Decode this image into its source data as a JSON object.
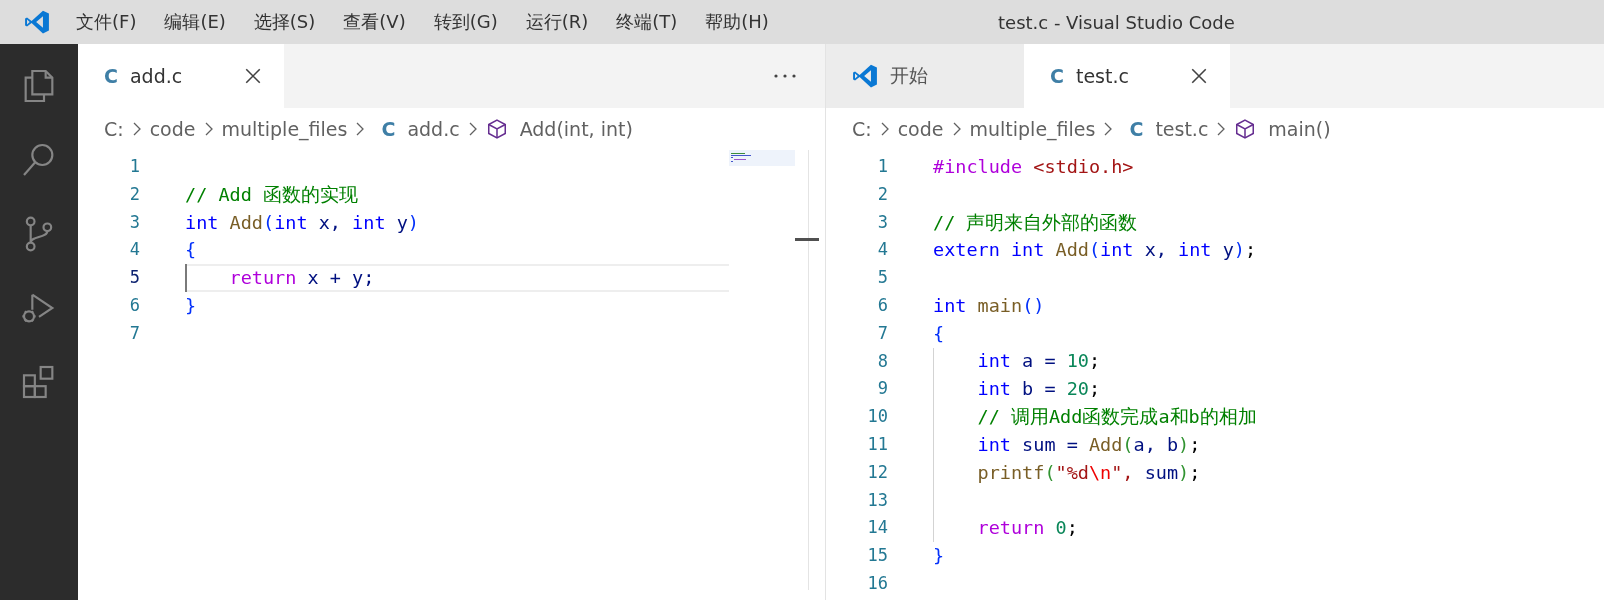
{
  "window": {
    "title": "test.c - Visual Studio Code"
  },
  "menu": [
    "文件(F)",
    "编辑(E)",
    "选择(S)",
    "查看(V)",
    "转到(G)",
    "运行(R)",
    "终端(T)",
    "帮助(H)"
  ],
  "editors": [
    {
      "minimap": true,
      "more_actions": true,
      "tabs": [
        {
          "label": "add.c",
          "kind": "c-file",
          "icon": "C",
          "selected": true
        }
      ],
      "breadcrumbs": [
        {
          "label": "C:",
          "kind": "folder"
        },
        {
          "label": "code",
          "kind": "folder"
        },
        {
          "label": "multiple_files",
          "kind": "folder"
        },
        {
          "label": "add.c",
          "kind": "c-file",
          "icon": "C"
        },
        {
          "label": "Add(int, int)",
          "kind": "symbol"
        }
      ],
      "lines": [
        {
          "number": "1",
          "current": false,
          "guide": false
        },
        {
          "number": "2",
          "current": false,
          "guide": false,
          "tokens": [
            {
              "text": "// Add 函数的实现",
              "color": "#008000"
            }
          ]
        },
        {
          "number": "3",
          "current": false,
          "guide": false,
          "tokens": [
            {
              "text": "int ",
              "color": "#0000ff"
            },
            {
              "text": "Add",
              "color": "#795e26"
            },
            {
              "text": "(",
              "color": "#0431fa"
            },
            {
              "text": "int ",
              "color": "#0000ff"
            },
            {
              "text": "x, ",
              "color": "#001080"
            },
            {
              "text": "int ",
              "color": "#0000ff"
            },
            {
              "text": "y",
              "color": "#001080"
            },
            {
              "text": ")",
              "color": "#0431fa"
            }
          ]
        },
        {
          "number": "4",
          "current": false,
          "guide": false,
          "tokens": [
            {
              "text": "{",
              "color": "#0431fa"
            }
          ]
        },
        {
          "number": "5",
          "current": true,
          "guide": true,
          "tokens": [
            {
              "text": "    return ",
              "color": "#af00db"
            },
            {
              "text": "x + y;",
              "color": "#001080"
            }
          ]
        },
        {
          "number": "6",
          "current": false,
          "guide": false,
          "tokens": [
            {
              "text": "}",
              "color": "#0431fa"
            }
          ]
        },
        {
          "number": "7",
          "current": false,
          "guide": false
        }
      ]
    },
    {
      "minimap": false,
      "more_actions": false,
      "tabs": [
        {
          "label": "开始",
          "kind": "welcome",
          "selected": false
        },
        {
          "label": "test.c",
          "kind": "c-file",
          "icon": "C",
          "selected": true
        }
      ],
      "breadcrumbs": [
        {
          "label": "C:",
          "kind": "folder"
        },
        {
          "label": "code",
          "kind": "folder"
        },
        {
          "label": "multiple_files",
          "kind": "folder"
        },
        {
          "label": "test.c",
          "kind": "c-file",
          "icon": "C"
        },
        {
          "label": "main()",
          "kind": "symbol"
        }
      ],
      "lines": [
        {
          "number": "1",
          "current": false,
          "guide": false,
          "tokens": [
            {
              "text": "#include ",
              "color": "#af00db"
            },
            {
              "text": "<stdio.h>",
              "color": "#a31515"
            }
          ]
        },
        {
          "number": "2",
          "current": false,
          "guide": false
        },
        {
          "number": "3",
          "current": false,
          "guide": false,
          "tokens": [
            {
              "text": "// 声明来自外部的函数",
              "color": "#008000"
            }
          ]
        },
        {
          "number": "4",
          "current": false,
          "guide": false,
          "tokens": [
            {
              "text": "extern int ",
              "color": "#0000ff"
            },
            {
              "text": "Add",
              "color": "#795e26"
            },
            {
              "text": "(",
              "color": "#0431fa"
            },
            {
              "text": "int ",
              "color": "#0000ff"
            },
            {
              "text": "x, ",
              "color": "#001080"
            },
            {
              "text": "int ",
              "color": "#0000ff"
            },
            {
              "text": "y",
              "color": "#001080"
            },
            {
              "text": ")",
              "color": "#0431fa"
            },
            {
              "text": ";",
              "color": "#000000"
            }
          ]
        },
        {
          "number": "5",
          "current": false,
          "guide": false
        },
        {
          "number": "6",
          "current": false,
          "guide": false,
          "tokens": [
            {
              "text": "int ",
              "color": "#0000ff"
            },
            {
              "text": "main",
              "color": "#795e26"
            },
            {
              "text": "()",
              "color": "#0431fa"
            }
          ]
        },
        {
          "number": "7",
          "current": false,
          "guide": false,
          "tokens": [
            {
              "text": "{",
              "color": "#0431fa"
            }
          ]
        },
        {
          "number": "8",
          "current": false,
          "guide": true,
          "tokens": [
            {
              "text": "    int ",
              "color": "#0000ff"
            },
            {
              "text": "a = ",
              "color": "#001080"
            },
            {
              "text": "10",
              "color": "#098658"
            },
            {
              "text": ";",
              "color": "#000000"
            }
          ]
        },
        {
          "number": "9",
          "current": false,
          "guide": true,
          "tokens": [
            {
              "text": "    int ",
              "color": "#0000ff"
            },
            {
              "text": "b = ",
              "color": "#001080"
            },
            {
              "text": "20",
              "color": "#098658"
            },
            {
              "text": ";",
              "color": "#000000"
            }
          ]
        },
        {
          "number": "10",
          "current": false,
          "guide": true,
          "tokens": [
            {
              "text": "    // 调用Add函数完成a和b的相加",
              "color": "#008000"
            }
          ]
        },
        {
          "number": "11",
          "current": false,
          "guide": true,
          "tokens": [
            {
              "text": "    int ",
              "color": "#0000ff"
            },
            {
              "text": "sum = ",
              "color": "#001080"
            },
            {
              "text": "Add",
              "color": "#795e26"
            },
            {
              "text": "(",
              "color": "#319331"
            },
            {
              "text": "a, b",
              "color": "#001080"
            },
            {
              "text": ")",
              "color": "#319331"
            },
            {
              "text": ";",
              "color": "#000000"
            }
          ]
        },
        {
          "number": "12",
          "current": false,
          "guide": true,
          "tokens": [
            {
              "text": "    printf",
              "color": "#795e26"
            },
            {
              "text": "(",
              "color": "#319331"
            },
            {
              "text": "\"%d",
              "color": "#a31515"
            },
            {
              "text": "\\n",
              "color": "#ee0000"
            },
            {
              "text": "\", ",
              "color": "#a31515"
            },
            {
              "text": "sum",
              "color": "#001080"
            },
            {
              "text": ")",
              "color": "#319331"
            },
            {
              "text": ";",
              "color": "#000000"
            }
          ]
        },
        {
          "number": "13",
          "current": false,
          "guide": true
        },
        {
          "number": "14",
          "current": false,
          "guide": true,
          "tokens": [
            {
              "text": "    return ",
              "color": "#af00db"
            },
            {
              "text": "0",
              "color": "#098658"
            },
            {
              "text": ";",
              "color": "#000000"
            }
          ]
        },
        {
          "number": "15",
          "current": false,
          "guide": false,
          "tokens": [
            {
              "text": "}",
              "color": "#0431fa"
            }
          ]
        },
        {
          "number": "16",
          "current": false,
          "guide": false
        }
      ]
    }
  ]
}
